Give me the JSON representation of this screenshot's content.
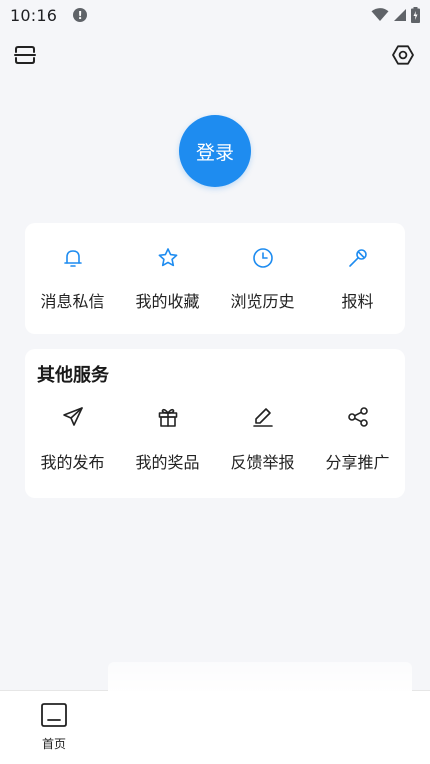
{
  "status_bar": {
    "time": "10:16",
    "alert_glyph": "!",
    "icons": [
      "wifi-icon",
      "signal-icon",
      "battery-charging-icon"
    ]
  },
  "top_bar": {
    "left_icon": "scan-icon",
    "right_icon": "settings-hexagon-icon"
  },
  "login": {
    "label": "登录",
    "color": "#1e8cf0"
  },
  "quick_actions": [
    {
      "label": "消息私信",
      "icon": "bell-icon"
    },
    {
      "label": "我的收藏",
      "icon": "star-icon"
    },
    {
      "label": "浏览历史",
      "icon": "clock-icon"
    },
    {
      "label": "报料",
      "icon": "microphone-icon"
    }
  ],
  "services": {
    "title": "其他服务",
    "items": [
      {
        "label": "我的发布",
        "icon": "paper-plane-icon"
      },
      {
        "label": "我的奖品",
        "icon": "gift-icon"
      },
      {
        "label": "反馈举报",
        "icon": "edit-pen-icon"
      },
      {
        "label": "分享推广",
        "icon": "share-icon"
      }
    ]
  },
  "bottom_nav": {
    "items": [
      {
        "label": "首页",
        "icon": "home-tab-icon"
      }
    ]
  },
  "colors": {
    "accent": "#1e8cf0",
    "background": "#f5f6f9",
    "card": "#ffffff"
  }
}
